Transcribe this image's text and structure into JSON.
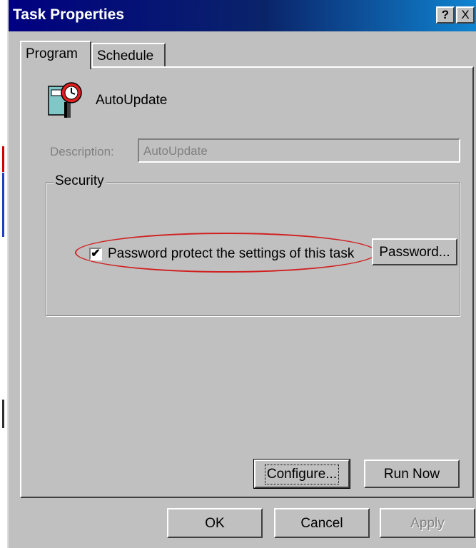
{
  "window": {
    "title": "Task Properties",
    "help_button": "?",
    "close_button": "X"
  },
  "tabs": [
    {
      "label": "Program",
      "active": true
    },
    {
      "label": "Schedule",
      "active": false
    }
  ],
  "task": {
    "name": "AutoUpdate",
    "icon": "scheduled-task-clock-icon"
  },
  "description": {
    "label": "Description:",
    "value": "AutoUpdate",
    "disabled": true
  },
  "security": {
    "group_label": "Security",
    "password_protect": {
      "label": "Password protect the settings of this task",
      "checked": true,
      "check_glyph": "✔"
    },
    "password_button": "Password...",
    "annotation_color": "#d12020"
  },
  "program_buttons": {
    "configure": "Configure...",
    "run_now": "Run Now"
  },
  "dialog_buttons": {
    "ok": "OK",
    "cancel": "Cancel",
    "apply": "Apply",
    "apply_disabled": true
  },
  "colors": {
    "face": "#c0c0c0",
    "title_start": "#000080",
    "title_end": "#1084d0"
  }
}
